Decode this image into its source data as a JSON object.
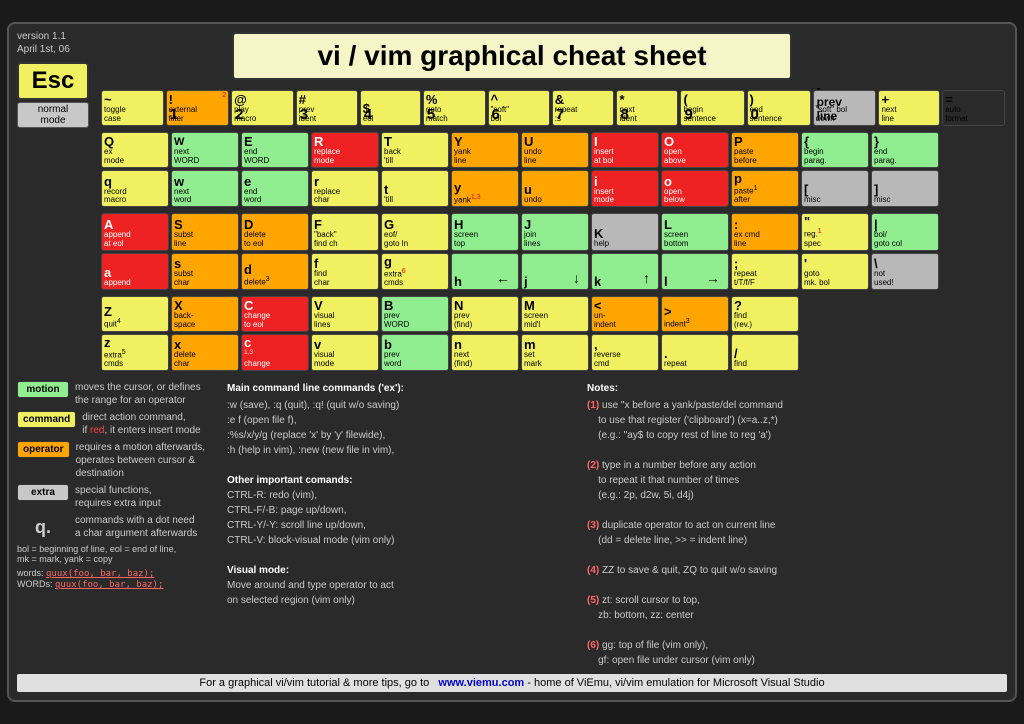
{
  "version": "version 1.1\nApril 1st, 06",
  "title": "vi / vim graphical cheat sheet",
  "esc": {
    "label": "Esc",
    "sublabel": "normal\nmode"
  },
  "bottom_bar": {
    "text": "For a graphical vi/vim tutorial & more tips, go to",
    "url": "www.viemu.com",
    "suffix": " - home of ViEmu, vi/vim emulation for Microsoft Visual Studio"
  },
  "legend": {
    "motion": "moves the cursor, or defines\nthe range for an operator",
    "command": "direct action command,\nif red, it enters insert mode",
    "operator": "requires a motion afterwards,\noperates between cursor &\ndestination",
    "extra": "special functions,\nrequires extra input",
    "q_dot": "commands with a dot need\na char argument afterwards"
  },
  "words_line": {
    "bol": "bol = beginning of line, eol = end of line,",
    "mk": "mk = mark, yank = copy",
    "words": "words:   quux(foo, bar, baz);",
    "WORDS": "WORDs:  quux(foo, bar, baz);"
  },
  "main_commands": {
    "title": "Main command line commands ('ex'):",
    "lines": [
      ":w (save), :q (quit), :q! (quit w/o saving)",
      ":e f (open file f),",
      ":%s/x/y/g (replace 'x' by 'y' filewide),",
      ":h (help in vim), :new (new file in vim),",
      "",
      "Other important comands:",
      "CTRL-R: redo (vim),",
      "CTRL-F/-B: page up/down,",
      "CTRL-Y/-Y: scroll line up/down,",
      "CTRL-V: block-visual mode (vim only)",
      "",
      "Visual mode:",
      "Move around and type operator to act",
      "on selected region (vim only)"
    ]
  },
  "notes": {
    "title": "Notes:",
    "items": [
      "(1) use \"x before a yank/paste/del command\n    to use that register ('clipboard') (x=a..z,*)\n    (e.g.: \"ay$ to copy rest of line to reg 'a')",
      "(2) type in a number before any action\n    to repeat it that number of times\n    (e.g.: 2p, d2w, 5i, d4j)",
      "(3) duplicate operator to act on current line\n    (dd = delete line, >> = indent line)",
      "(4) ZZ to save & quit, ZQ to quit w/o saving",
      "(5) zt: scroll cursor to top,\n    zb: bottom, zz: center",
      "(6) gg: top of file (vim only),\n    gf: open file under cursor (vim only)"
    ]
  }
}
